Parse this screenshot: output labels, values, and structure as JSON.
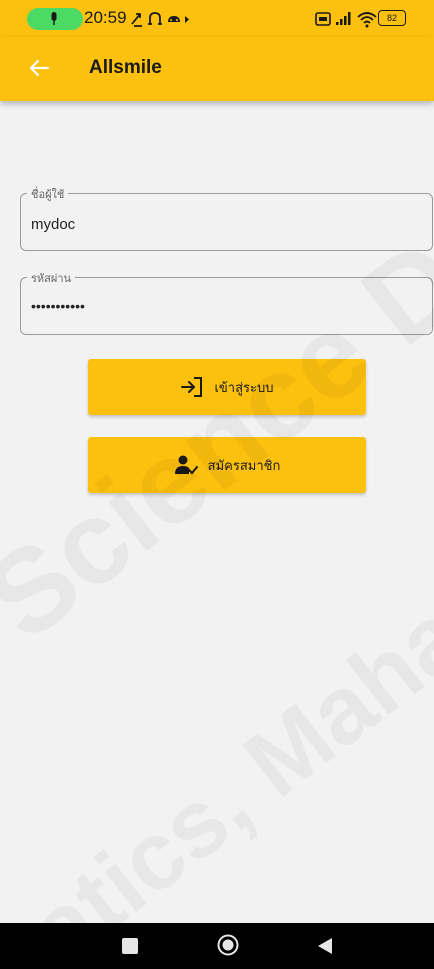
{
  "status_bar": {
    "time": "20:59",
    "battery": "82",
    "icons_left": [
      "mic-icon",
      "notification-icons"
    ],
    "icons_right": [
      "sim-icon",
      "signal-icon",
      "wifi-icon",
      "battery-icon"
    ]
  },
  "app_bar": {
    "title": "Allsmile",
    "back_icon": "arrow-left-icon"
  },
  "form": {
    "username": {
      "label": "ชื่อผู้ใช้",
      "value": "mydoc"
    },
    "password": {
      "label": "รหัสผ่าน",
      "value": "•••••••••••"
    }
  },
  "buttons": {
    "login": {
      "label": "เข้าสู่ระบบ",
      "icon": "login-icon"
    },
    "register": {
      "label": "สมัครสมาชิก",
      "icon": "person-check-icon"
    }
  },
  "watermark": {
    "line1": "Science Depa",
    "line2": "atics, Mahasarak"
  },
  "colors": {
    "accent": "#fcc00e",
    "background": "#f2f2f2"
  }
}
